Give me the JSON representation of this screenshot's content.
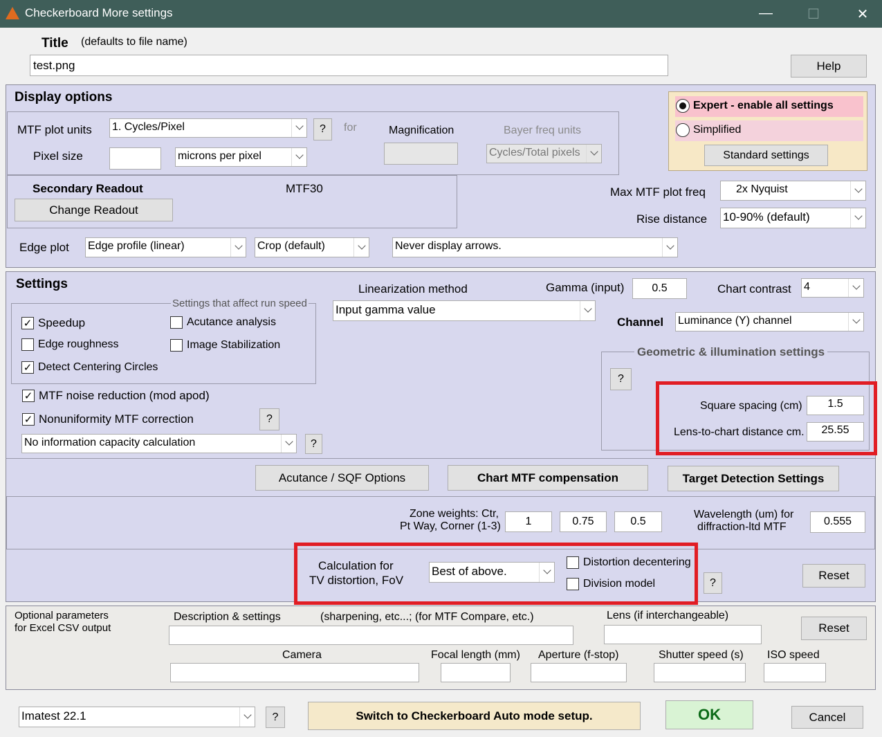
{
  "window": {
    "title": "Checkerboard More settings",
    "minimize": "—",
    "maximize": "☐",
    "close": "✕"
  },
  "title_section": {
    "label": "Title",
    "hint": "(defaults to file name)",
    "value": "test.png",
    "help": "Help"
  },
  "display": {
    "heading": "Display options",
    "mtf_units_label": "MTF plot units",
    "mtf_units_value": "1. Cycles/Pixel",
    "q": "?",
    "for_label": "for",
    "magnification_label": "Magnification",
    "bayer_label": "Bayer freq units",
    "bayer_value": "Cycles/Total pixels",
    "pixel_size_label": "Pixel size",
    "pixel_size_value": "",
    "pixel_unit_value": "microns per pixel",
    "secondary_label": "Secondary Readout",
    "secondary_value": "MTF30",
    "change_readout": "Change Readout",
    "expert_label": "Expert - enable all settings",
    "simplified_label": "Simplified",
    "standard_settings": "Standard settings",
    "max_freq_label": "Max MTF plot freq",
    "max_freq_value": "2x Nyquist",
    "rise_label": "Rise distance",
    "rise_value": "10-90% (default)",
    "edge_plot_label": "Edge plot",
    "edge_profile_value": "Edge profile (linear)",
    "crop_value": "Crop (default)",
    "arrows_value": "Never display arrows."
  },
  "settings": {
    "heading": "Settings",
    "speed_legend": "Settings that affect run speed",
    "speedup": "Speedup",
    "acutance": "Acutance analysis",
    "edge_rough": "Edge roughness",
    "image_stab": "Image Stabilization",
    "centering": "Detect Centering Circles",
    "noise": "MTF noise reduction (mod  apod)",
    "nonuni": "Nonuniformity MTF correction",
    "q": "?",
    "info_cap_value": "No information capacity calculation",
    "lin_label": "Linearization method",
    "lin_value": "Input gamma value",
    "gamma_label": "Gamma (input)",
    "gamma_value": "0.5",
    "contrast_label": "Chart contrast",
    "contrast_value": "4",
    "channel_label": "Channel",
    "channel_value": "Luminance (Y) channel",
    "geo_legend": "Geometric & illumination settings",
    "square_label": "Square spacing (cm)",
    "square_value": "1.5",
    "lens_dist_label": "Lens-to-chart distance cm.",
    "lens_dist_value": "25.55",
    "acutance_sqf": "Acutance / SQF Options",
    "chart_mtf": "Chart MTF compensation",
    "target_detect": "Target Detection Settings",
    "zone_label_1": "Zone weights:  Ctr,",
    "zone_label_2": "Pt Way, Corner (1-3)",
    "zone_ctr": "1",
    "zone_pt": "0.75",
    "zone_corner": "0.5",
    "wavelength_label_1": "Wavelength (um) for",
    "wavelength_label_2": "diffraction-ltd MTF",
    "wavelength_value": "0.555",
    "calc_label_1": "Calculation for",
    "calc_label_2": "TV distortion, FoV",
    "calc_value": "Best of above.",
    "dist_decenter": "Distortion decentering",
    "division": "Division model",
    "reset": "Reset"
  },
  "optional": {
    "label_1": "Optional parameters",
    "label_2": "for Excel CSV output",
    "desc_label": "Description & settings",
    "desc_hint": "(sharpening, etc...; (for MTF Compare, etc.)",
    "lens_label": "Lens (if interchangeable)",
    "reset": "Reset",
    "camera_label": "Camera",
    "focal_label": "Focal length (mm)",
    "aperture_label": "Aperture (f-stop)",
    "shutter_label": "Shutter speed (s)",
    "iso_label": "ISO speed"
  },
  "footer": {
    "version_value": "Imatest 22.1",
    "q": "?",
    "switch": "Switch to Checkerboard Auto mode setup.",
    "ok": "OK",
    "cancel": "Cancel"
  }
}
